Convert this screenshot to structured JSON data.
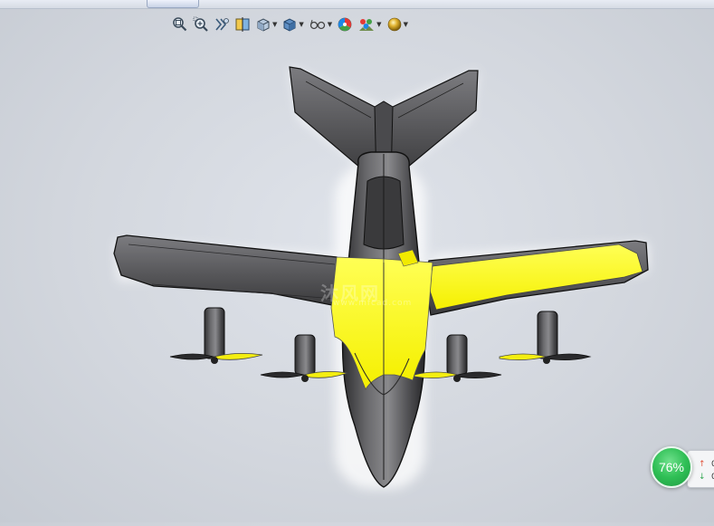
{
  "toolbar": {
    "buttons": [
      {
        "icon": "zoom-to-fit-icon",
        "has_dropdown": false
      },
      {
        "icon": "zoom-to-area-icon",
        "has_dropdown": false
      },
      {
        "icon": "previous-view-icon",
        "has_dropdown": false
      },
      {
        "icon": "section-view-icon",
        "has_dropdown": false
      },
      {
        "icon": "view-orientation-icon",
        "has_dropdown": true
      },
      {
        "icon": "display-style-icon",
        "has_dropdown": true
      },
      {
        "icon": "hide-show-items-icon",
        "has_dropdown": true
      },
      {
        "icon": "edit-appearance-icon",
        "has_dropdown": false
      },
      {
        "icon": "apply-scene-icon",
        "has_dropdown": true
      },
      {
        "icon": "view-settings-icon",
        "has_dropdown": true
      }
    ]
  },
  "viewport": {
    "model": "aircraft-top-view",
    "body_color": "#5a5a5c",
    "highlight_color": "#ffff1a",
    "background": "#d6dae1"
  },
  "watermark": {
    "text_cn": "沐风网",
    "text_url": "www.mfcad.com"
  },
  "status_widget": {
    "percent": "76%",
    "up_value": "0",
    "down_value": "0",
    "circle_color": "#2fbf55"
  }
}
